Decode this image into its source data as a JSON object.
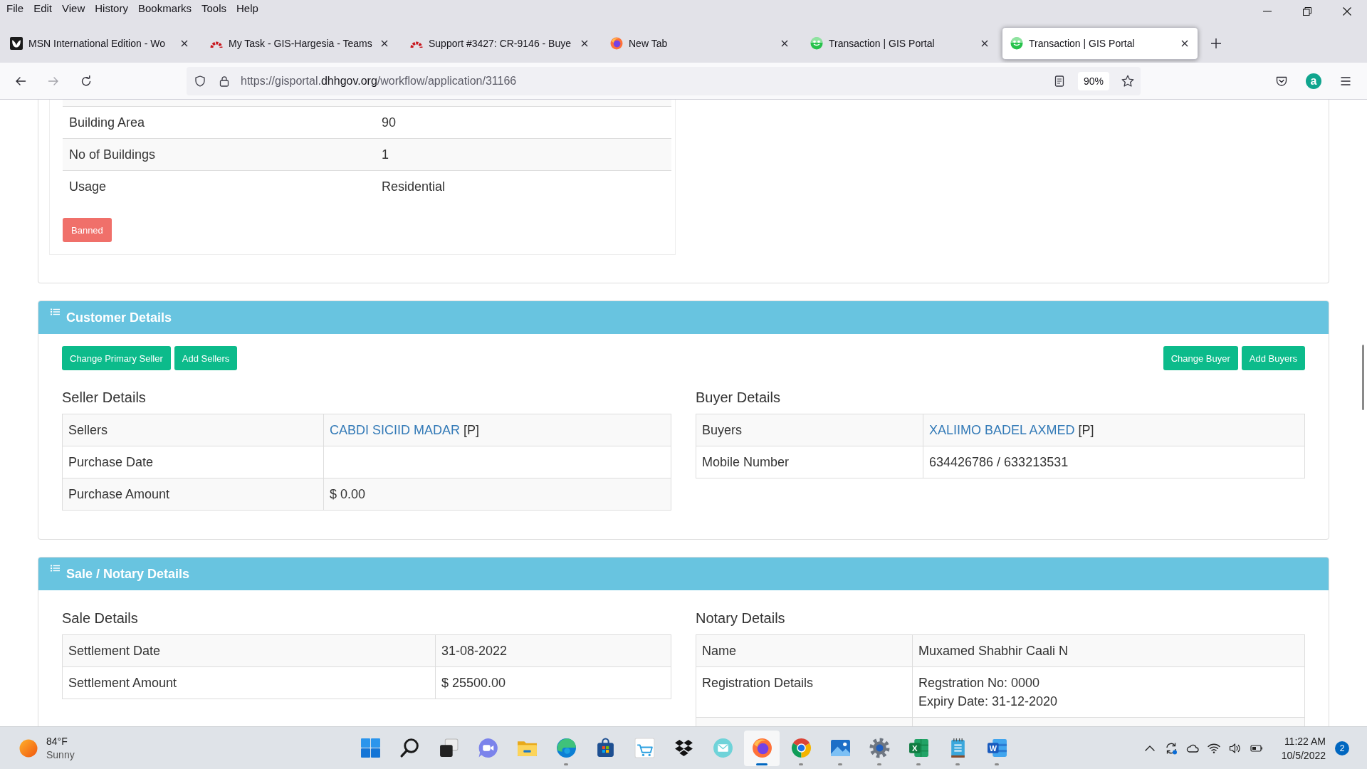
{
  "browser": {
    "menu": [
      "File",
      "Edit",
      "View",
      "History",
      "Bookmarks",
      "Tools",
      "Help"
    ],
    "tabs": [
      {
        "kind": "msn",
        "title": "MSN International Edition - Wo",
        "selected": false
      },
      {
        "kind": "redmine",
        "title": "My Task - GIS-Hargesia - Teams",
        "selected": false
      },
      {
        "kind": "redmine",
        "title": "Support #3427: CR-9146 - Buye",
        "selected": false
      },
      {
        "kind": "firefox",
        "title": "New Tab",
        "selected": false
      },
      {
        "kind": "portal",
        "title": "Transaction | GIS Portal",
        "selected": false
      },
      {
        "kind": "portal",
        "title": "Transaction | GIS Portal",
        "selected": true
      }
    ],
    "back": {
      "disabled": false
    },
    "forward": {
      "disabled": true
    },
    "address": {
      "prefix": "https://gisportal.",
      "domain": "dhhgov.org",
      "path": "/workflow/application/31166"
    },
    "zoom": "90%",
    "account_initial": "a"
  },
  "property": {
    "rows": [
      {
        "label": "Building Area",
        "value": "90"
      },
      {
        "label": "No of Buildings",
        "value": "1"
      },
      {
        "label": "Usage",
        "value": "Residential"
      }
    ],
    "status": "Banned"
  },
  "customer": {
    "title": "Customer Details",
    "seller_actions": [
      "Change Primary Seller",
      "Add Sellers"
    ],
    "buyer_actions": [
      "Change Buyer",
      "Add Buyers"
    ],
    "seller": {
      "heading": "Seller Details",
      "rows": [
        {
          "kind": "link",
          "label": "Sellers",
          "link": "CABDI SICIID MADAR",
          "suffix": "[P]"
        },
        {
          "kind": "text",
          "label": "Purchase Date"
        },
        {
          "kind": "text",
          "label": "Purchase Amount",
          "value": "$ 0.00"
        }
      ]
    },
    "buyer": {
      "heading": "Buyer Details",
      "rows": [
        {
          "kind": "link",
          "label": "Buyers",
          "link": "XALIIMO BADEL AXMED",
          "suffix": "[P]"
        },
        {
          "kind": "text",
          "label": "Mobile Number",
          "value": "634426786 / 633213531"
        }
      ]
    }
  },
  "sale": {
    "title": "Sale / Notary Details",
    "sale": {
      "heading": "Sale Details",
      "rows": [
        {
          "kind": "text",
          "label": "Settlement Date",
          "value": "31-08-2022"
        },
        {
          "kind": "text",
          "label": "Settlement Amount",
          "value": "$ 25500.00"
        }
      ]
    },
    "notary": {
      "heading": "Notary Details",
      "rows": [
        {
          "kind": "text",
          "label": "Name",
          "value": "Muxamed Shabhir Caali N"
        },
        {
          "kind": "lines",
          "label": "Registration Details",
          "lines": [
            "Regstration No: 0000",
            "Expiry Date: 31-12-2020"
          ]
        },
        {
          "kind": "blank"
        }
      ]
    }
  },
  "taskbar": {
    "weather": {
      "temperature": "84°F",
      "condition": "Sunny"
    },
    "apps": [
      {
        "kind": "start",
        "running": false,
        "selected": false
      },
      {
        "kind": "search",
        "running": false,
        "selected": false
      },
      {
        "kind": "task_view",
        "running": false,
        "selected": false
      },
      {
        "kind": "chat",
        "running": false,
        "selected": false
      },
      {
        "kind": "explorer",
        "running": false,
        "selected": false
      },
      {
        "kind": "edge",
        "running": true,
        "selected": false
      },
      {
        "kind": "store",
        "running": false,
        "selected": false
      },
      {
        "kind": "amazon",
        "running": false,
        "selected": false
      },
      {
        "kind": "dropbox",
        "running": false,
        "selected": false
      },
      {
        "kind": "mail",
        "running": false,
        "selected": false
      },
      {
        "kind": "firefox",
        "running": true,
        "selected": true
      },
      {
        "kind": "chrome",
        "running": true,
        "selected": false
      },
      {
        "kind": "photos",
        "running": true,
        "selected": false
      },
      {
        "kind": "settings",
        "running": true,
        "selected": false
      },
      {
        "kind": "excel",
        "running": true,
        "selected": false,
        "letter": "X"
      },
      {
        "kind": "notepad",
        "running": true,
        "selected": false
      },
      {
        "kind": "word",
        "running": true,
        "selected": false,
        "letter": "W"
      }
    ],
    "clock": {
      "time": "11:22 AM",
      "date": "10/5/2022"
    },
    "notifications": "2"
  }
}
